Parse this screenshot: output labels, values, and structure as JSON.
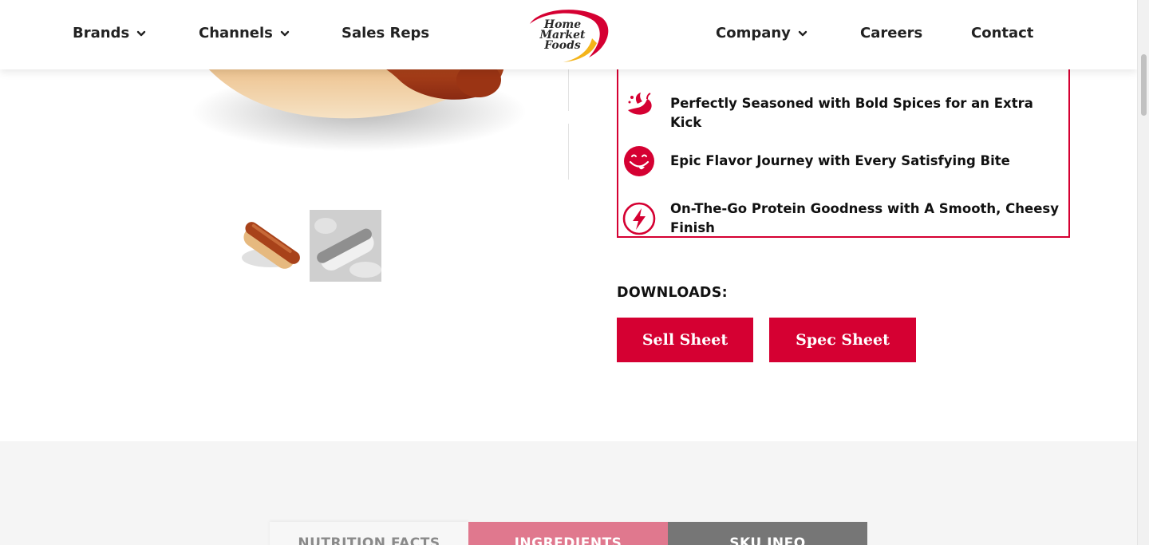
{
  "header": {
    "nav_left": [
      {
        "label": "Brands",
        "has_dropdown": true
      },
      {
        "label": "Channels",
        "has_dropdown": true
      },
      {
        "label": "Sales Reps",
        "has_dropdown": false
      }
    ],
    "nav_right": [
      {
        "label": "Company",
        "has_dropdown": true
      },
      {
        "label": "Careers",
        "has_dropdown": false
      },
      {
        "label": "Contact",
        "has_dropdown": false
      }
    ],
    "logo": {
      "line1": "Home",
      "line2": "Market",
      "line3": "Foods"
    }
  },
  "features": [
    {
      "icon": "chili-pepper-icon",
      "text": "Perfectly Seasoned with Bold Spices for an Extra Kick"
    },
    {
      "icon": "tongue-smile-icon",
      "text": "Epic Flavor Journey with Every Satisfying Bite"
    },
    {
      "icon": "lightning-bolt-icon",
      "text": "On-The-Go Protein Goodness with A Smooth, Cheesy Finish"
    }
  ],
  "downloads": {
    "label": "DOWNLOADS:",
    "buttons": [
      "Sell Sheet",
      "Spec Sheet"
    ]
  },
  "tabs": [
    {
      "label": "NUTRITION FACTS",
      "active": false
    },
    {
      "label": "INGREDIENTS",
      "active": true
    },
    {
      "label": "SKU INFO",
      "active": false
    }
  ],
  "colors": {
    "brand_red": "#d50032",
    "tab_active": "#e0788e",
    "tab_dark": "#767676",
    "tab_light": "#f7f7f7",
    "section_bg": "#f5f5f5"
  }
}
